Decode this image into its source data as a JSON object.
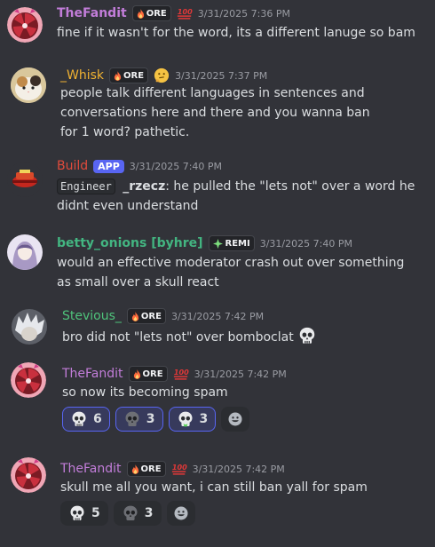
{
  "messages": [
    {
      "author": "TheFandit",
      "author_color": "#c27dd9",
      "tag": "ORE",
      "timestamp": "3/31/2025 7:36 PM",
      "text": "fine if it wasn't for the word, its a different lanuge so bam"
    },
    {
      "author": "_Whisk",
      "author_color": "#f0b232",
      "tag": "ORE",
      "timestamp": "3/31/2025 7:37 PM",
      "emoji": "thinking-face-icon",
      "text": "people talk different languages in sentences and conversations here and there and you wanna ban for 1 word? pathetic."
    },
    {
      "author": "Build",
      "author_color": "#e04b3c",
      "app_badge": "APP",
      "timestamp": "3/31/2025 7:40 PM",
      "code_label": "Engineer",
      "mention": "_rzecz",
      "text": " he pulled the \"lets not\" over a word he didnt even understand"
    },
    {
      "author": "betty_onions [byhre]",
      "author_color": "#43b581",
      "tag": "REMI",
      "timestamp": "3/31/2025 7:40 PM",
      "text": "would an effective moderator crash out over something as small over a skull react"
    },
    {
      "author": "Stevious_",
      "author_color": "#4fc37b",
      "tag": "ORE",
      "timestamp": "3/31/2025 7:42 PM",
      "text": "bro did not \"lets not\" over bomboclat"
    },
    {
      "author": "TheFandit",
      "author_color": "#c27dd9",
      "tag": "ORE",
      "timestamp": "3/31/2025 7:42 PM",
      "text": "so now its becoming spam",
      "reactions": [
        {
          "icon": "skull-icon",
          "count": "6",
          "me": true
        },
        {
          "icon": "dark-skull-icon",
          "count": "3",
          "me": true
        },
        {
          "icon": "green-skull-icon",
          "count": "3",
          "me": true
        }
      ]
    },
    {
      "author": "TheFandit",
      "author_color": "#c27dd9",
      "tag": "ORE",
      "timestamp": "3/31/2025 7:42 PM",
      "text": "skull me all you want, i can still ban yall for spam",
      "reactions": [
        {
          "icon": "skull-icon",
          "count": "5",
          "me": false
        },
        {
          "icon": "dark-skull-icon",
          "count": "3",
          "me": false
        }
      ]
    }
  ]
}
